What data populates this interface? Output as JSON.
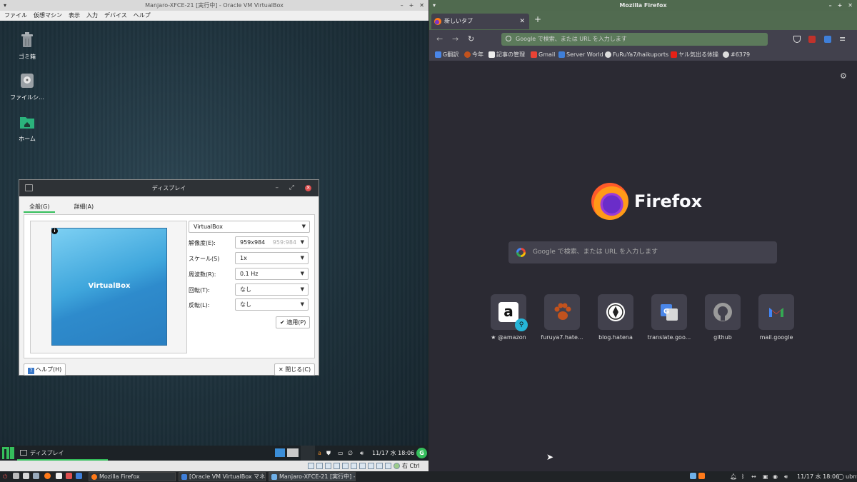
{
  "vbox": {
    "title": "Manjaro-XFCE-21 [実行中] - Oracle VM VirtualBox",
    "menu": [
      "ファイル",
      "仮想マシン",
      "表示",
      "入力",
      "デバイス",
      "ヘルプ"
    ],
    "desktop_icons": [
      {
        "label": "ゴミ箱",
        "icon": "trash-icon"
      },
      {
        "label": "ファイルシ...",
        "icon": "drive-icon"
      },
      {
        "label": "ホーム",
        "icon": "home-folder-icon"
      }
    ],
    "host_key": "右 Ctrl"
  },
  "display_dialog": {
    "title": "ディスプレイ",
    "tabs": [
      {
        "label": "全般(G)",
        "active": true
      },
      {
        "label": "詳細(A)",
        "active": false
      }
    ],
    "monitor_label": "VirtualBox",
    "monitor_select": "VirtualBox",
    "fields": [
      {
        "label": "解像度(E):",
        "value": "959x984",
        "ghost": "959:984"
      },
      {
        "label": "スケール(S)",
        "value": "1x"
      },
      {
        "label": "周波数(R):",
        "value": "0.1 Hz"
      },
      {
        "label": "回転(T):",
        "value": "なし"
      },
      {
        "label": "反転(L):",
        "value": "なし"
      }
    ],
    "apply_label": "適用(P)",
    "help_label": "ヘルプ(H)",
    "close_label": "閉じる(C)"
  },
  "guest_taskbar": {
    "task_label": "ディスプレイ",
    "clock": "11/17 水 18:06"
  },
  "firefox": {
    "window_title": "Mozilla Firefox",
    "tab_title": "新しいタブ",
    "url_placeholder": "Google で検索、または URL を入力します",
    "bookmarks": [
      "G翻訳",
      "今年",
      "記事の管理",
      "Gmail",
      "Server World",
      "FuRuYa7/haikuports",
      "ヤル気出る体操",
      "#6379"
    ],
    "wordmark": "Firefox",
    "search_placeholder": "Google で検索、または URL を入力します",
    "top_sites": [
      {
        "label": "@amazon",
        "prefix": "★",
        "color": "#ffffff"
      },
      {
        "label": "furuya7.hate...",
        "color": "#c2521d"
      },
      {
        "label": "blog.hatena",
        "color": "#ffffff"
      },
      {
        "label": "translate.goo...",
        "color": "#4a86e8"
      },
      {
        "label": "github",
        "color": "#8a8a8a"
      },
      {
        "label": "mail.google",
        "color": "#ea4335"
      }
    ]
  },
  "host_taskbar": {
    "tasks": [
      "Mozilla Firefox",
      "[Oracle VM VirtualBox マネ...",
      "Manjaro-XFCE-21 [実行中] -..."
    ],
    "clock": "11/17 水 18:06",
    "user": "ubnt"
  }
}
